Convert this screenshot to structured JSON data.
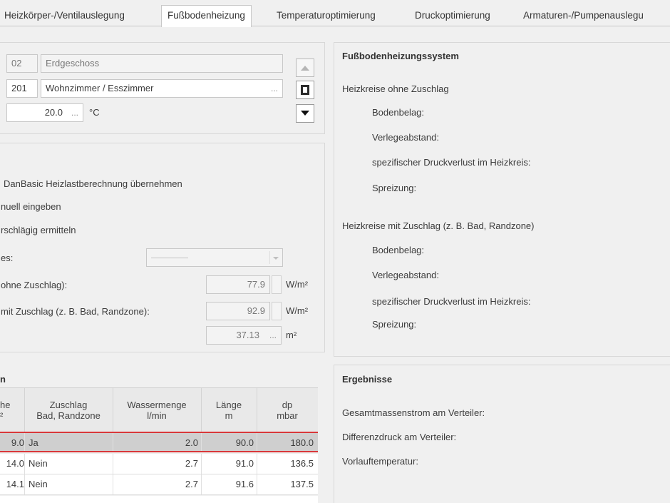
{
  "tabs": [
    {
      "label": "Heizkörper-/Ventilauslegung",
      "active": false
    },
    {
      "label": "Fußbodenheizung",
      "active": true
    },
    {
      "label": "Temperaturoptimierung",
      "active": false
    },
    {
      "label": "Druckoptimierung",
      "active": false
    },
    {
      "label": "Armaturen-/Pumpenauslegu",
      "active": false
    }
  ],
  "room": {
    "floor_no": "02",
    "floor_name": "Erdgeschoss",
    "room_no": "201",
    "room_name": "Wohnzimmer / Esszimmer",
    "temperature": "20.0",
    "temp_unit": "°C",
    "ellipsis": "..."
  },
  "heat_load": {
    "option1": "DanBasic Heizlastberechnung übernehmen",
    "option2": "nuell eingeben",
    "option3": "rschlägig ermitteln",
    "dropdown_label": "es:",
    "dropdown_value": "————",
    "row1_label": "ohne Zuschlag):",
    "row1_value": "77.9",
    "row1_unit": "W/m²",
    "row2_label": "mit Zuschlag (z. B. Bad, Randzone):",
    "row2_value": "92.9",
    "row2_unit": "W/m²",
    "row3_value": "37.13",
    "row3_unit": "m²"
  },
  "table": {
    "section_title": "n",
    "headers": {
      "c1a": "he",
      "c1b": "²",
      "c2a": "Zuschlag",
      "c2b": "Bad, Randzone",
      "c3a": "Wassermenge",
      "c3b": "l/min",
      "c4a": "Länge",
      "c4b": "m",
      "c5a": "dp",
      "c5b": "mbar"
    },
    "rows": [
      {
        "area": "9.0",
        "zuschlag": "Ja",
        "wasser": "2.0",
        "laenge": "90.0",
        "dp": "180.0"
      },
      {
        "area": "14.0",
        "zuschlag": "Nein",
        "wasser": "2.7",
        "laenge": "91.0",
        "dp": "136.5"
      },
      {
        "area": "14.1",
        "zuschlag": "Nein",
        "wasser": "2.7",
        "laenge": "91.6",
        "dp": "137.5"
      }
    ]
  },
  "system": {
    "title": "Fußbodenheizungssystem",
    "group1": "Heizkreise ohne Zuschlag",
    "g1_belag": "Bodenbelag:",
    "g1_abstand": "Verlegeabstand:",
    "g1_druck": "spezifischer Druckverlust im Heizkreis:",
    "g1_spreizung": "Spreizung:",
    "group2": "Heizkreise mit Zuschlag (z. B. Bad, Randzone)",
    "g2_belag": "Bodenbelag:",
    "g2_abstand": "Verlegeabstand:",
    "g2_druck": "spezifischer Druckverlust im Heizkreis:",
    "g2_spreizung": "Spreizung:"
  },
  "results": {
    "title": "Ergebnisse",
    "massenstrom": "Gesamtmassenstrom am Verteiler:",
    "differenzdruck": "Differenzdruck am Verteiler:",
    "vorlauf": "Vorlauftemperatur:"
  },
  "colors": {
    "selection_border": "#d9383a",
    "selection_fill": "#cfcfcf"
  }
}
